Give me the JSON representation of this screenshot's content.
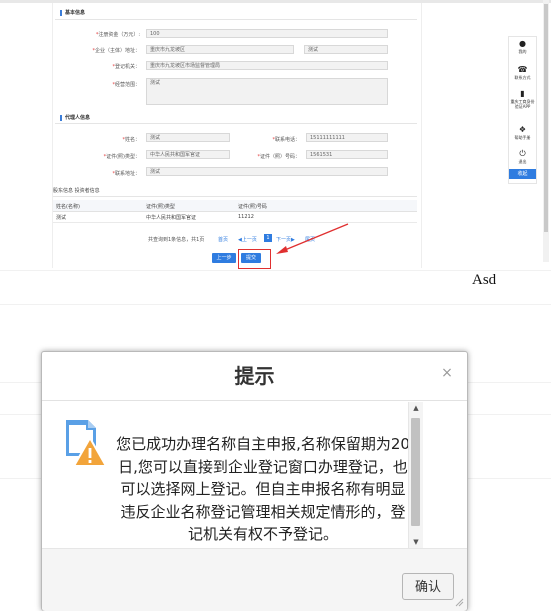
{
  "basic_info": {
    "section_title": "基本信息",
    "capital_label": "注册资金（万元）:",
    "capital_value": "100",
    "address_label": "企业（主体）地址：",
    "address_value": "重庆市九龙坡区",
    "address_detail": "测试",
    "registry_label": "登记机关：",
    "registry_value": "重庆市九龙坡区市场监督管理局",
    "scope_label": "经营范围：",
    "scope_value": "测试"
  },
  "agent_info": {
    "section_title": "代理人信息",
    "name_label": "姓名：",
    "name_value": "测试",
    "phone_label": "联系电话：",
    "phone_value": "15111111111",
    "id_type_label": "证件(照)类型：",
    "id_type_value": "中华人民共和国军官证",
    "id_no_label": "证件（照）号码：",
    "id_no_value": "1561531",
    "address_label": "联系地址：",
    "address_value": "测试"
  },
  "investor_section": {
    "title": "股东信息 投资者信息",
    "columns": [
      "姓名(名称)",
      "证件(照)类型",
      "证件(照)号码"
    ],
    "rows": [
      [
        "测试",
        "中华人民共和国军官证",
        "11212"
      ]
    ]
  },
  "pager": {
    "summary": "共查询到1条信息，共1页",
    "first": "首页",
    "prev": "◀上一页",
    "current": "1",
    "next": "下一页▶",
    "last": "尾页"
  },
  "actions": {
    "prev_step": "上一步",
    "submit": "提交"
  },
  "sidebar": {
    "items": [
      {
        "label": "我的",
        "icon": "person-icon"
      },
      {
        "label": "联系方式",
        "icon": "phone-icon"
      },
      {
        "label": "重庆工商身份验证APP",
        "icon": "mobile-icon"
      },
      {
        "label": "帮助手册",
        "icon": "help-icon"
      },
      {
        "label": "退出",
        "icon": "power-icon"
      }
    ],
    "collapse": "收起"
  },
  "annotation_text": "Asd",
  "dialog": {
    "title": "提示",
    "close": "×",
    "message": "您已成功办理名称自主申报,名称保留期为20日,您可以直接到企业登记窗口办理登记，也可以选择网上登记。但自主申报名称有明显违反企业名称登记管理相关规定情形的，登记机关有权不予登记。",
    "confirm": "确认",
    "icon": "warning-document-icon"
  },
  "colors": {
    "primary": "#2f7ce0",
    "required": "#e23a3a",
    "highlight": "#e03030",
    "warning_orange": "#f2a43a"
  }
}
